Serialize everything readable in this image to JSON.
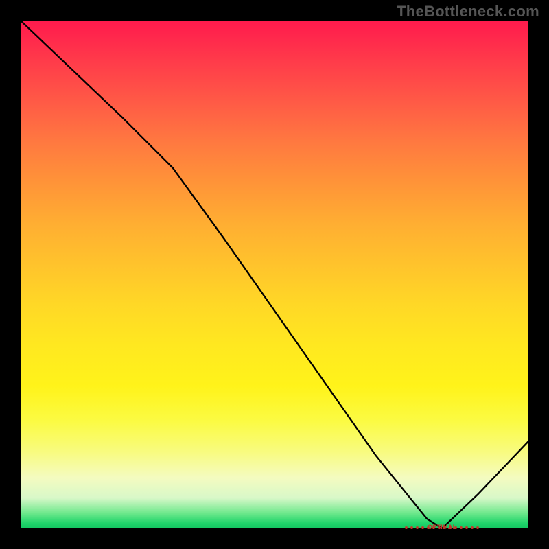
{
  "watermark": "TheBottleneck.com",
  "optimal_label": "OPTIMAL",
  "chart_data": {
    "type": "line",
    "title": "",
    "xlabel": "",
    "ylabel": "",
    "x": [
      0,
      10,
      20,
      30,
      40,
      50,
      60,
      70,
      80,
      83,
      90,
      100
    ],
    "values": [
      105,
      95,
      85,
      74.5,
      60,
      45,
      30,
      15,
      2,
      0,
      7,
      18
    ],
    "ylim": [
      0,
      105
    ],
    "xlim": [
      0,
      100
    ],
    "optimal_range_x": [
      76,
      90
    ],
    "background_gradient": {
      "top": "#ff1a4d",
      "mid": "#ffd826",
      "bottom": "#14c661"
    }
  }
}
